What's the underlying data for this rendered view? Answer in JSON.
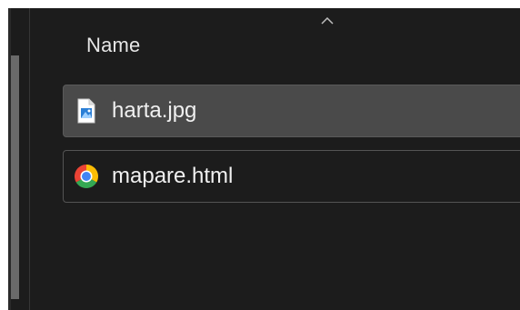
{
  "file_list": {
    "columns": [
      {
        "label": "Name",
        "sort": "ascending",
        "sort_icon": "chevron-up-icon"
      }
    ],
    "files": [
      {
        "name": "harta.jpg",
        "icon": "image-file-icon",
        "selected": true
      },
      {
        "name": "mapare.html",
        "icon": "chrome-icon",
        "selected": false
      }
    ]
  },
  "colors": {
    "background": "#1c1c1c",
    "selected_row": "#4a4a4a",
    "row_border": "#545454",
    "text": "#f0f0f0"
  }
}
